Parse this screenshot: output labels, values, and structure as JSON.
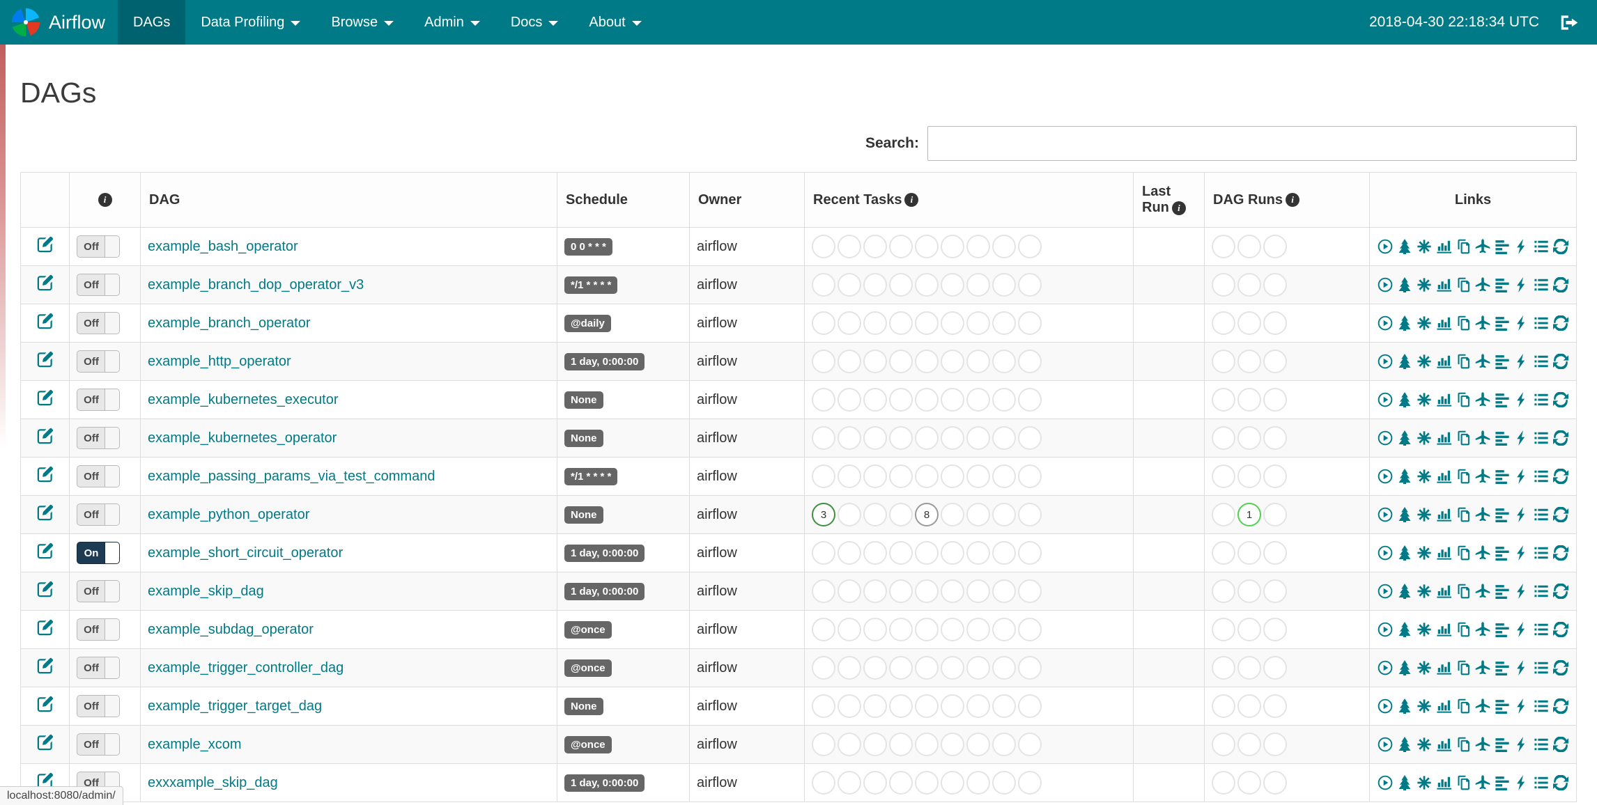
{
  "navbar": {
    "brand": "Airflow",
    "items": [
      {
        "label": "DAGs",
        "active": true,
        "dropdown": false
      },
      {
        "label": "Data Profiling",
        "active": false,
        "dropdown": true
      },
      {
        "label": "Browse",
        "active": false,
        "dropdown": true
      },
      {
        "label": "Admin",
        "active": false,
        "dropdown": true
      },
      {
        "label": "Docs",
        "active": false,
        "dropdown": true
      },
      {
        "label": "About",
        "active": false,
        "dropdown": true
      }
    ],
    "clock": "2018-04-30 22:18:34 UTC"
  },
  "page": {
    "title": "DAGs",
    "search_label": "Search:",
    "search_value": "",
    "status_bar": "localhost:8080/admin/"
  },
  "table": {
    "headers": {
      "dag": "DAG",
      "schedule": "Schedule",
      "owner": "Owner",
      "recent_tasks": "Recent Tasks",
      "last_run_line1": "Last",
      "last_run_line2": "Run",
      "dag_runs": "DAG Runs",
      "links": "Links"
    },
    "recent_task_slots": 9,
    "dag_run_slots": 3
  },
  "toggle": {
    "on_label": "On",
    "off_label": "Off"
  },
  "state_colors": {
    "success": "#3c8f3c",
    "running": "#4fd14f",
    "none": "#9a9a9a"
  },
  "link_icons": [
    "play-circle",
    "tree",
    "asterisk",
    "bar-chart",
    "copy",
    "plane",
    "gantt",
    "bolt",
    "list",
    "refresh"
  ],
  "dags": [
    {
      "name": "example_bash_operator",
      "schedule": "0 0 * * *",
      "owner": "airflow",
      "paused": true,
      "recent_tasks": [],
      "dag_runs": []
    },
    {
      "name": "example_branch_dop_operator_v3",
      "schedule": "*/1 * * * *",
      "owner": "airflow",
      "paused": true,
      "recent_tasks": [],
      "dag_runs": []
    },
    {
      "name": "example_branch_operator",
      "schedule": "@daily",
      "owner": "airflow",
      "paused": true,
      "recent_tasks": [],
      "dag_runs": []
    },
    {
      "name": "example_http_operator",
      "schedule": "1 day, 0:00:00",
      "owner": "airflow",
      "paused": true,
      "recent_tasks": [],
      "dag_runs": []
    },
    {
      "name": "example_kubernetes_executor",
      "schedule": "None",
      "owner": "airflow",
      "paused": true,
      "recent_tasks": [],
      "dag_runs": []
    },
    {
      "name": "example_kubernetes_operator",
      "schedule": "None",
      "owner": "airflow",
      "paused": true,
      "recent_tasks": [],
      "dag_runs": []
    },
    {
      "name": "example_passing_params_via_test_command",
      "schedule": "*/1 * * * *",
      "owner": "airflow",
      "paused": true,
      "recent_tasks": [],
      "dag_runs": []
    },
    {
      "name": "example_python_operator",
      "schedule": "None",
      "owner": "airflow",
      "paused": true,
      "recent_tasks": [
        {
          "slot": 0,
          "count": "3",
          "state": "success"
        },
        {
          "slot": 4,
          "count": "8",
          "state": "none"
        }
      ],
      "dag_runs": [
        {
          "slot": 1,
          "count": "1",
          "state": "running"
        }
      ]
    },
    {
      "name": "example_short_circuit_operator",
      "schedule": "1 day, 0:00:00",
      "owner": "airflow",
      "paused": false,
      "recent_tasks": [],
      "dag_runs": []
    },
    {
      "name": "example_skip_dag",
      "schedule": "1 day, 0:00:00",
      "owner": "airflow",
      "paused": true,
      "recent_tasks": [],
      "dag_runs": []
    },
    {
      "name": "example_subdag_operator",
      "schedule": "@once",
      "owner": "airflow",
      "paused": true,
      "recent_tasks": [],
      "dag_runs": []
    },
    {
      "name": "example_trigger_controller_dag",
      "schedule": "@once",
      "owner": "airflow",
      "paused": true,
      "recent_tasks": [],
      "dag_runs": []
    },
    {
      "name": "example_trigger_target_dag",
      "schedule": "None",
      "owner": "airflow",
      "paused": true,
      "recent_tasks": [],
      "dag_runs": []
    },
    {
      "name": "example_xcom",
      "schedule": "@once",
      "owner": "airflow",
      "paused": true,
      "recent_tasks": [],
      "dag_runs": []
    },
    {
      "name": "exxxample_skip_dag",
      "schedule": "1 day, 0:00:00",
      "owner": "airflow",
      "paused": true,
      "recent_tasks": [],
      "dag_runs": []
    }
  ]
}
